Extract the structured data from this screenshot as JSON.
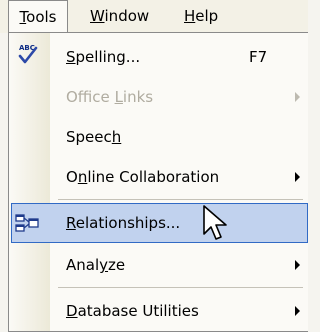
{
  "menubar": {
    "items": [
      {
        "label_pre": "",
        "label_ul": "T",
        "label_post": "ools"
      },
      {
        "label_pre": "",
        "label_ul": "W",
        "label_post": "indow"
      },
      {
        "label_pre": "",
        "label_ul": "H",
        "label_post": "elp"
      }
    ]
  },
  "menu": {
    "items": [
      {
        "label_pre": "",
        "label_ul": "S",
        "label_post": "pelling...",
        "shortcut": "F7",
        "icon": "spelling-abc-check-icon",
        "enabled": true
      },
      {
        "label_pre": "Office ",
        "label_ul": "L",
        "label_post": "inks",
        "icon": "",
        "enabled": false,
        "submenu": true
      },
      {
        "label_pre": "Speec",
        "label_ul": "h",
        "label_post": "",
        "icon": "",
        "enabled": true
      },
      {
        "label_pre": "O",
        "label_ul": "n",
        "label_post": "line Collaboration",
        "icon": "",
        "enabled": true,
        "submenu": true
      },
      {
        "label_pre": "",
        "label_ul": "R",
        "label_post": "elationships...",
        "icon": "relationships-icon",
        "enabled": true,
        "highlighted": true
      },
      {
        "label_pre": "Anal",
        "label_ul": "y",
        "label_post": "ze",
        "icon": "",
        "enabled": true,
        "submenu": true
      },
      {
        "label_pre": "",
        "label_ul": "D",
        "label_post": "atabase Utilities",
        "icon": "",
        "enabled": true,
        "submenu": true
      }
    ]
  },
  "colors": {
    "highlight_fill": "#c1d2ee",
    "highlight_border": "#316ac5",
    "disabled_text": "#b0aca0"
  }
}
